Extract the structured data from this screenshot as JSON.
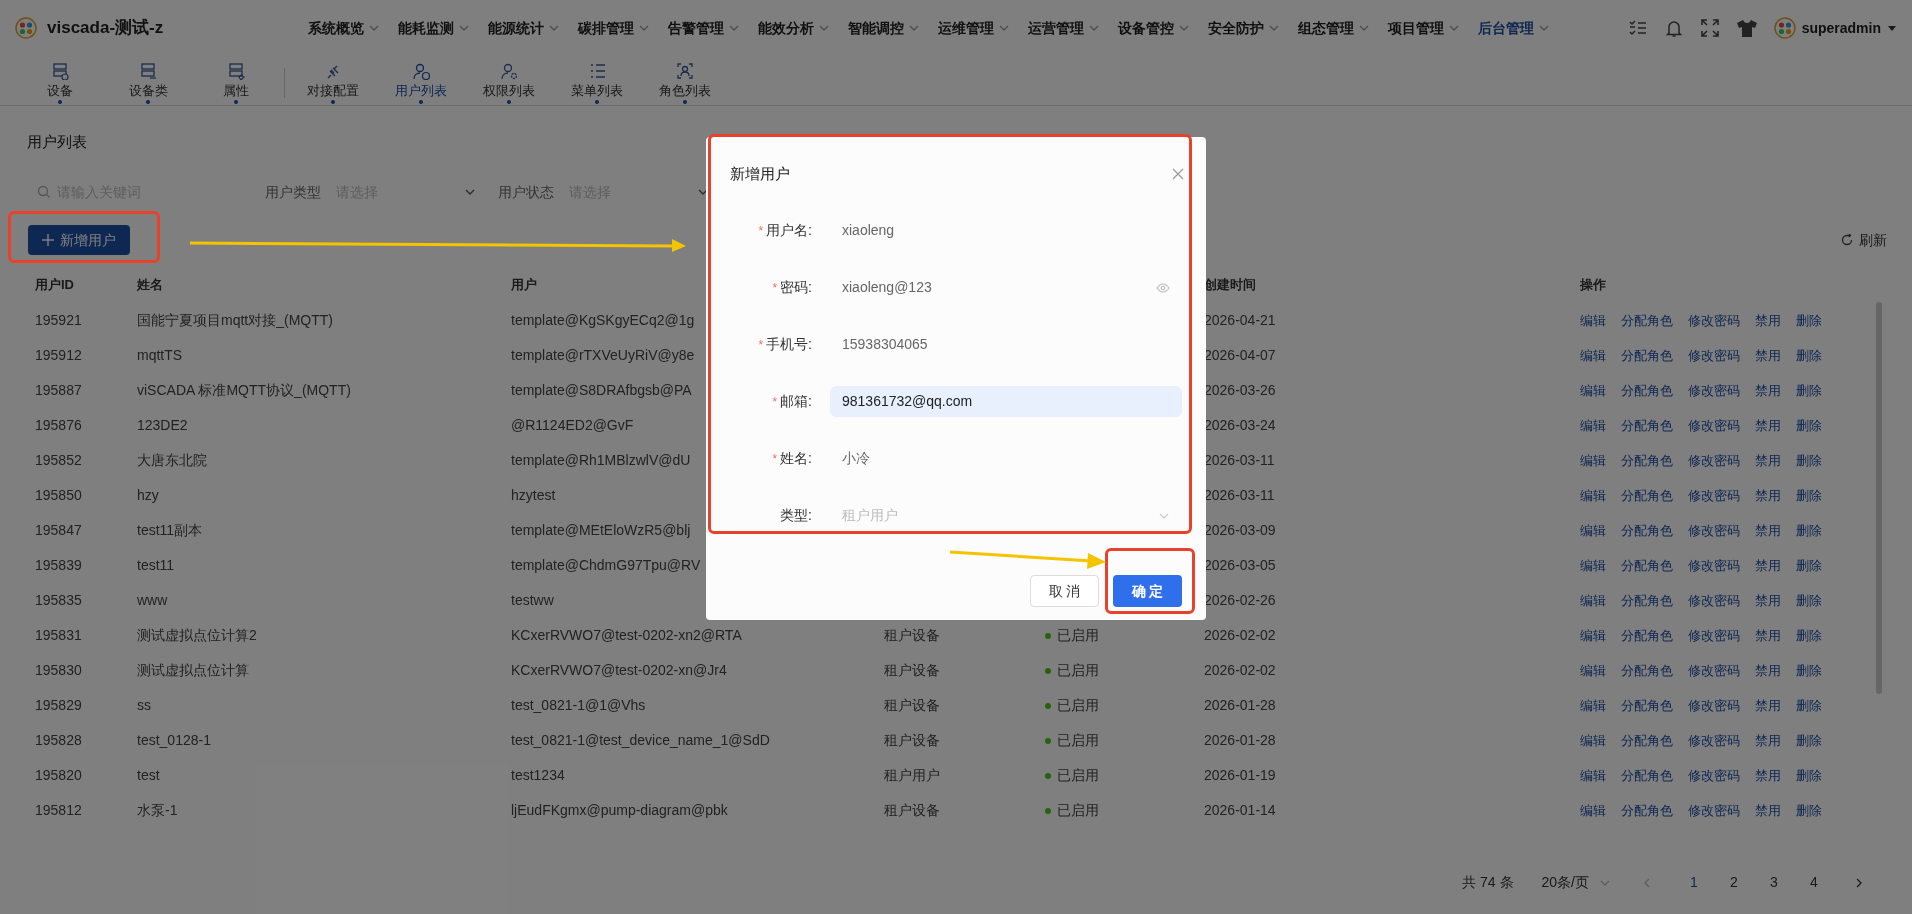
{
  "app": {
    "title": "viscada-测试-z",
    "user": "superadmin"
  },
  "nav": [
    {
      "label": "系统概览",
      "selected": false
    },
    {
      "label": "能耗监测",
      "selected": false
    },
    {
      "label": "能源统计",
      "selected": false
    },
    {
      "label": "碳排管理",
      "selected": false
    },
    {
      "label": "告警管理",
      "selected": false
    },
    {
      "label": "能效分析",
      "selected": false
    },
    {
      "label": "智能调控",
      "selected": false
    },
    {
      "label": "运维管理",
      "selected": false
    },
    {
      "label": "运营管理",
      "selected": false
    },
    {
      "label": "设备管控",
      "selected": false
    },
    {
      "label": "安全防护",
      "selected": false
    },
    {
      "label": "组态管理",
      "selected": false
    },
    {
      "label": "项目管理",
      "selected": false
    },
    {
      "label": "后台管理",
      "selected": true
    }
  ],
  "tabs": [
    {
      "label": "设备",
      "selected": false
    },
    {
      "label": "设备类",
      "selected": false
    },
    {
      "label": "属性",
      "selected": false
    },
    {
      "label": "对接配置",
      "selected": false
    },
    {
      "label": "用户列表",
      "selected": true
    },
    {
      "label": "权限列表",
      "selected": false
    },
    {
      "label": "菜单列表",
      "selected": false
    },
    {
      "label": "角色列表",
      "selected": false
    }
  ],
  "page_title": "用户列表",
  "filters": {
    "search_placeholder": "请输入关键词",
    "selects": [
      {
        "label": "用户类型",
        "placeholder": "请选择"
      },
      {
        "label": "用户状态",
        "placeholder": "请选择"
      }
    ]
  },
  "add_button": "新增用户",
  "refresh": "刷新",
  "table": {
    "columns": [
      "用户ID",
      "姓名",
      "用户",
      "",
      "",
      "创建时间",
      "操作"
    ],
    "rows": [
      {
        "id": "195921",
        "name": "国能宁夏项目mqtt对接_(MQTT)",
        "user": "template@KgSKgyECq2@1g",
        "created": "2026-04-21",
        "actions": [
          "编辑",
          "分配角色",
          "修改密码",
          "禁用",
          "删除"
        ]
      },
      {
        "id": "195912",
        "name": "mqttTS",
        "user": "template@rTXVeUyRiV@y8e",
        "created": "2026-04-07",
        "actions": [
          "编辑",
          "分配角色",
          "修改密码",
          "禁用",
          "删除"
        ]
      },
      {
        "id": "195887",
        "name": "viSCADA 标准MQTT协议_(MQTT)",
        "user": "template@S8DRAfbgsb@PA",
        "created": "2026-03-26",
        "actions": [
          "编辑",
          "分配角色",
          "修改密码",
          "禁用",
          "删除"
        ]
      },
      {
        "id": "195876",
        "name": "123DE2",
        "user": "@R1124ED2@GvF",
        "created": "2026-03-24",
        "actions": [
          "编辑",
          "分配角色",
          "修改密码",
          "禁用",
          "删除"
        ]
      },
      {
        "id": "195852",
        "name": "大唐东北院",
        "user": "template@Rh1MBlzwlV@dU",
        "created": "2026-03-11",
        "actions": [
          "编辑",
          "分配角色",
          "修改密码",
          "禁用",
          "删除"
        ]
      },
      {
        "id": "195850",
        "name": "hzy",
        "user": "hzytest",
        "created": "2026-03-11",
        "actions": [
          "编辑",
          "分配角色",
          "修改密码",
          "禁用",
          "删除"
        ]
      },
      {
        "id": "195847",
        "name": "test11副本",
        "user": "template@MEtEloWzR5@blj",
        "created": "2026-03-09",
        "actions": [
          "编辑",
          "分配角色",
          "修改密码",
          "禁用",
          "删除"
        ]
      },
      {
        "id": "195839",
        "name": "test11",
        "user": "template@ChdmG97Tpu@RV",
        "created": "2026-03-05",
        "actions": [
          "编辑",
          "分配角色",
          "修改密码",
          "禁用",
          "删除"
        ]
      },
      {
        "id": "195835",
        "name": "www",
        "user": "testww",
        "created": "2026-02-26",
        "actions": [
          "编辑",
          "分配角色",
          "修改密码",
          "禁用",
          "删除"
        ]
      },
      {
        "id": "195831",
        "name": "测试虚拟点位计算2",
        "user": "KCxerRVWO7@test-0202-xn2@RTA",
        "type": "租户设备",
        "status": "已启用",
        "color": "#29620d",
        "created": "2026-02-02",
        "actions": [
          "编辑",
          "分配角色",
          "修改密码",
          "禁用",
          "删除"
        ]
      },
      {
        "id": "195830",
        "name": "测试虚拟点位计算",
        "user": "KCxerRVWO7@test-0202-xn@Jr4",
        "type": "租户设备",
        "status": "已启用",
        "color": "#29620d",
        "created": "2026-02-02",
        "actions": [
          "编辑",
          "分配角色",
          "修改密码",
          "禁用",
          "删除"
        ]
      },
      {
        "id": "195829",
        "name": "ss",
        "user": "test_0821-1@1@Vhs",
        "type": "租户设备",
        "status": "已启用",
        "color": "#29620d",
        "created": "2026-01-28",
        "actions": [
          "编辑",
          "分配角色",
          "修改密码",
          "禁用",
          "删除"
        ]
      },
      {
        "id": "195828",
        "name": "test_0128-1",
        "user": "test_0821-1@test_device_name_1@SdD",
        "type": "租户设备",
        "status": "已启用",
        "color": "#29620d",
        "created": "2026-01-28",
        "actions": [
          "编辑",
          "分配角色",
          "修改密码",
          "禁用",
          "删除"
        ]
      },
      {
        "id": "195820",
        "name": "test",
        "user": "test1234",
        "type": "租户用户",
        "status": "已启用",
        "color": "#29620d",
        "created": "2026-01-19",
        "actions": [
          "编辑",
          "分配角色",
          "修改密码",
          "禁用",
          "删除"
        ]
      },
      {
        "id": "195812",
        "name": "水泵-1",
        "user": "ljEudFKgmx@pump-diagram@pbk",
        "type": "租户设备",
        "status": "已启用",
        "color": "#29620d",
        "created": "2026-01-14",
        "actions": [
          "编辑",
          "分配角色",
          "修改密码",
          "禁用",
          "删除"
        ]
      }
    ]
  },
  "pagination": {
    "total": "共 74 条",
    "page_size": "20条/页",
    "pages": [
      {
        "label": "1",
        "selected": true
      },
      {
        "label": "2",
        "selected": false
      },
      {
        "label": "3",
        "selected": false
      },
      {
        "label": "4",
        "selected": false
      }
    ]
  },
  "dialog": {
    "title": "新增用户",
    "fields": [
      {
        "kind": "text",
        "mark": "*",
        "label": "用户名:",
        "value": "xiaoleng",
        "focused": false,
        "disabled": false
      },
      {
        "kind": "password",
        "mark": "*",
        "label": "密码:",
        "value": "xiaoleng@123",
        "focused": false,
        "disabled": false
      },
      {
        "kind": "text",
        "mark": "*",
        "label": "手机号:",
        "value": "15938304065",
        "focused": false,
        "disabled": false
      },
      {
        "kind": "text",
        "mark": "*",
        "label": "邮箱:",
        "value": "981361732@qq.com",
        "focused": true,
        "disabled": false
      },
      {
        "kind": "text",
        "mark": "*",
        "label": "姓名:",
        "value": "小冷",
        "focused": false,
        "disabled": false
      },
      {
        "kind": "select",
        "label": "类型:",
        "value": "租户用户",
        "focused": false,
        "disabled": true
      }
    ],
    "buttons": [
      {
        "label": "取 消",
        "kind": "secondary"
      },
      {
        "label": "确 定",
        "kind": "primary"
      }
    ]
  }
}
